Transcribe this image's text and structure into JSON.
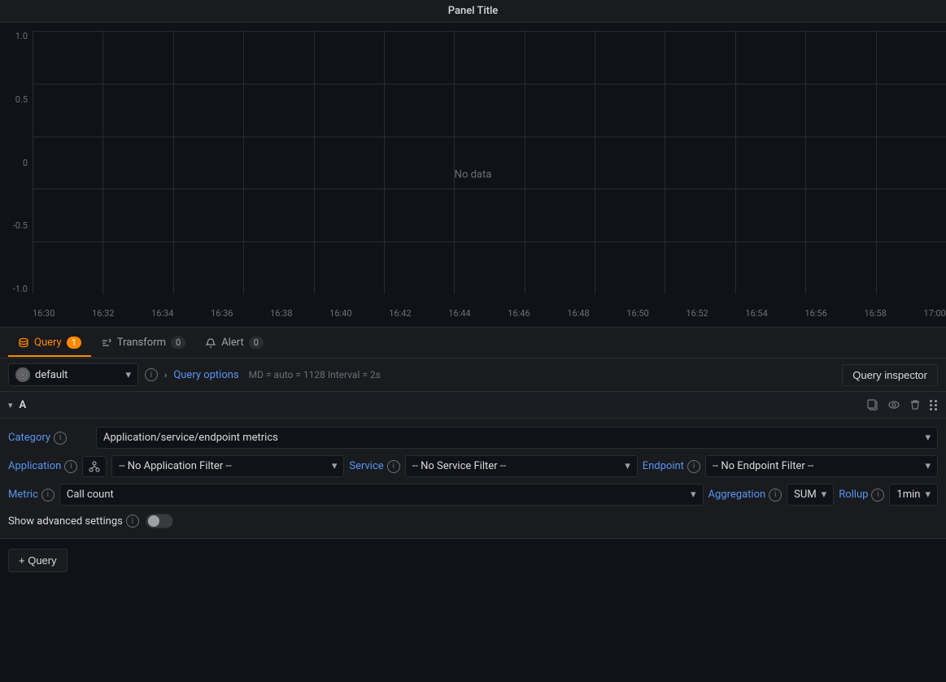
{
  "panel": {
    "title": "Panel Title"
  },
  "chart": {
    "no_data_label": "No data",
    "y_axis": [
      "1.0",
      "0.5",
      "0",
      "-0.5",
      "-1.0"
    ],
    "x_axis": [
      "16:30",
      "16:32",
      "16:34",
      "16:36",
      "16:38",
      "16:40",
      "16:42",
      "16:44",
      "16:46",
      "16:48",
      "16:50",
      "16:52",
      "16:54",
      "16:56",
      "16:58",
      "17:00"
    ]
  },
  "tabs": [
    {
      "id": "query",
      "label": "Query",
      "badge": "1",
      "active": true
    },
    {
      "id": "transform",
      "label": "Transform",
      "badge": "0",
      "active": false
    },
    {
      "id": "alert",
      "label": "Alert",
      "badge": "0",
      "active": false
    }
  ],
  "datasource": {
    "name": "default",
    "placeholder": "default"
  },
  "query_options": {
    "label": "Query options",
    "meta": "MD = auto = 1128   Interval = 2s"
  },
  "query_inspector": {
    "label": "Query inspector"
  },
  "query_block": {
    "letter": "A",
    "category": {
      "label": "Category",
      "value": "Application/service/endpoint metrics"
    },
    "application": {
      "label": "Application",
      "filter_placeholder": "-- No Application Filter --"
    },
    "service": {
      "label": "Service",
      "filter_placeholder": "-- No Service Filter --"
    },
    "endpoint": {
      "label": "Endpoint",
      "filter_placeholder": "-- No Endpoint Filter --"
    },
    "metric": {
      "label": "Metric",
      "value": "Call count"
    },
    "aggregation": {
      "label": "Aggregation",
      "value": "SUM"
    },
    "rollup": {
      "label": "Rollup",
      "value": "1min"
    },
    "advanced_settings": {
      "label": "Show advanced settings"
    }
  },
  "add_query": {
    "label": "+ Query"
  }
}
